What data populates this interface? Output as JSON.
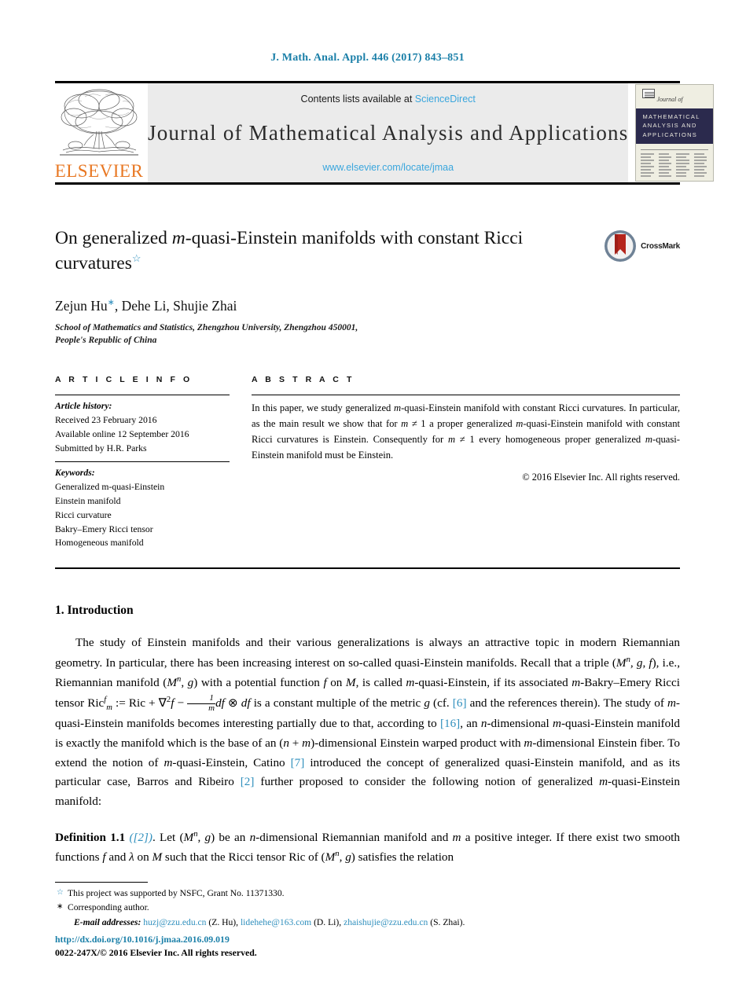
{
  "running_head": "J. Math. Anal. Appl. 446 (2017) 843–851",
  "banner": {
    "publisher_wordmark": "ELSEVIER",
    "contents_prefix": "Contents lists available at ",
    "contents_link": "ScienceDirect",
    "journal_title": "Journal of Mathematical Analysis and Applications",
    "journal_url": "www.elsevier.com/locate/jmaa",
    "cover": {
      "journal_of": "Journal of",
      "band_line1": "MATHEMATICAL",
      "band_line2": "ANALYSIS AND",
      "band_line3": "APPLICATIONS"
    }
  },
  "article": {
    "title": "On generalized m-quasi-Einstein manifolds with constant Ricci curvatures",
    "title_part1": "On generalized ",
    "title_italic": "m",
    "title_part2": "-quasi-Einstein manifolds with constant Ricci curvatures",
    "title_footnote_mark": "☆",
    "crossmark_label": "CrossMark",
    "authors": "Zejun Hu",
    "author_mark": "∗",
    "authors_rest": ", Dehe Li, Shujie Zhai",
    "affiliation_line1": "School of Mathematics and Statistics, Zhengzhou University, Zhengzhou 450001,",
    "affiliation_line2": "People's Republic of China"
  },
  "info": {
    "heading": "A R T I C L E   I N F O",
    "history_heading": "Article history:",
    "history": [
      "Received 23 February 2016",
      "Available online 12 September 2016",
      "Submitted by H.R. Parks"
    ],
    "keywords_heading": "Keywords:",
    "keywords": [
      "Generalized m-quasi-Einstein",
      "Einstein manifold",
      "Ricci curvature",
      "Bakry–Emery Ricci tensor",
      "Homogeneous manifold"
    ]
  },
  "abstract": {
    "heading": "A B S T R A C T",
    "text": "In this paper, we study generalized m-quasi-Einstein manifold with constant Ricci curvatures. In particular, as the main result we show that for m ≠ 1 a proper generalized m-quasi-Einstein manifold with constant Ricci curvatures is Einstein. Consequently for m ≠ 1 every homogeneous proper generalized m-quasi-Einstein manifold must be Einstein.",
    "copyright": "© 2016 Elsevier Inc. All rights reserved."
  },
  "body": {
    "section_title": "1.  Introduction",
    "paragraph1_a": "The study of Einstein manifolds and their various generalizations is always an attractive topic in modern Riemannian geometry. In particular, there has been increasing interest on so-called quasi-Einstein manifolds. Recall that a triple (M",
    "paragraph1_full": "The study of Einstein manifolds and their various generalizations is always an attractive topic in modern Riemannian geometry. In particular, there has been increasing interest on so-called quasi-Einstein manifolds. Recall that a triple (Mn, g, f), i.e., Riemannian manifold (Mn, g) with a potential function f on M, is called m-quasi-Einstein, if its associated m-Bakry–Emery Ricci tensor Ricfm := Ric + ∇2f − (1/m)df ⊗ df is a constant multiple of the metric g (cf. [6] and the references therein). The study of m-quasi-Einstein manifolds becomes interesting partially due to that, according to [16], an n-dimensional m-quasi-Einstein manifold is exactly the manifold which is the base of an (n + m)-dimensional Einstein warped product with m-dimensional Einstein fiber. To extend the notion of m-quasi-Einstein, Catino [7] introduced the concept of generalized quasi-Einstein manifold, and as its particular case, Barros and Ribeiro [2] further proposed to consider the following notion of generalized m-quasi-Einstein manifold:",
    "citations": {
      "c6": "[6]",
      "c16": "[16]",
      "c7": "[7]",
      "c2": "[2]"
    },
    "definition_label": "Definition 1.1",
    "definition_cite": "([2])",
    "definition_text": ". Let (Mn, g) be an n-dimensional Riemannian manifold and m a positive integer. If there exist two smooth functions f and λ on M such that the Ricci tensor Ric of (Mn, g) satisfies the relation"
  },
  "footnotes": {
    "star_mark": "☆",
    "star_text": "This project was supported by NSFC, Grant No. 11371330.",
    "asterisk_mark": "∗",
    "asterisk_text": "Corresponding author.",
    "emails_label": "E-mail addresses:",
    "emails": [
      {
        "address": "huzj@zzu.edu.cn",
        "who": "(Z. Hu)"
      },
      {
        "address": "lidehehe@163.com",
        "who": "(D. Li)"
      },
      {
        "address": "zhaishujie@zzu.edu.cn",
        "who": "(S. Zhai)"
      }
    ]
  },
  "imprint": {
    "doi": "http://dx.doi.org/10.1016/j.jmaa.2016.09.019",
    "issn_line": "0022-247X/© 2016 Elsevier Inc. All rights reserved."
  },
  "colors": {
    "link_blue": "#2f8fbd",
    "header_blue": "#1a7fa8",
    "elsevier_orange": "#e87722",
    "banner_gray": "#ebebeb",
    "cover_navy": "#2b2a4d"
  }
}
